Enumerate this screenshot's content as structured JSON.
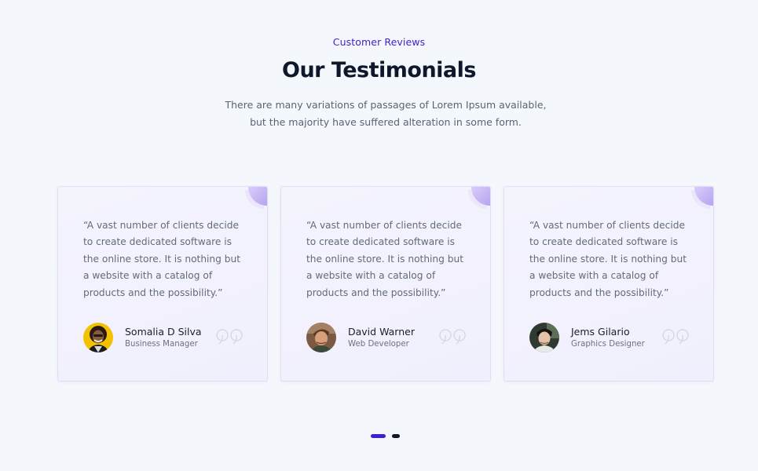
{
  "header": {
    "eyebrow": "Customer Reviews",
    "title": "Our Testimonials",
    "subtitle": "There are many variations of passages of Lorem Ipsum available, but the majority have suffered alteration in some form."
  },
  "testimonials": [
    {
      "quote": "“A vast number of clients decide to create dedicated software is the online store. It is nothing but a website with a catalog of products and the possibility.”",
      "name": "Somalia D Silva",
      "role": "Business Manager"
    },
    {
      "quote": "“A vast number of clients decide to create dedicated software is the online store. It is nothing but a website with a catalog of products and the possibility.”",
      "name": "David Warner",
      "role": "Web Developer"
    },
    {
      "quote": "“A vast number of clients decide to create dedicated software is the online store. It is nothing but a website with a catalog of products and the possibility.”",
      "name": "Jems Gilario",
      "role": "Graphics Designer"
    }
  ],
  "pagination": {
    "active_index": 0,
    "count": 2
  },
  "colors": {
    "accent": "#3f1fcf",
    "background": "#f4f7fb",
    "card_border": "#e1dcf8",
    "corner": "#b5a4ef"
  },
  "icons": {
    "quote": "quote-mark-icon",
    "corner": "corner-accent"
  }
}
